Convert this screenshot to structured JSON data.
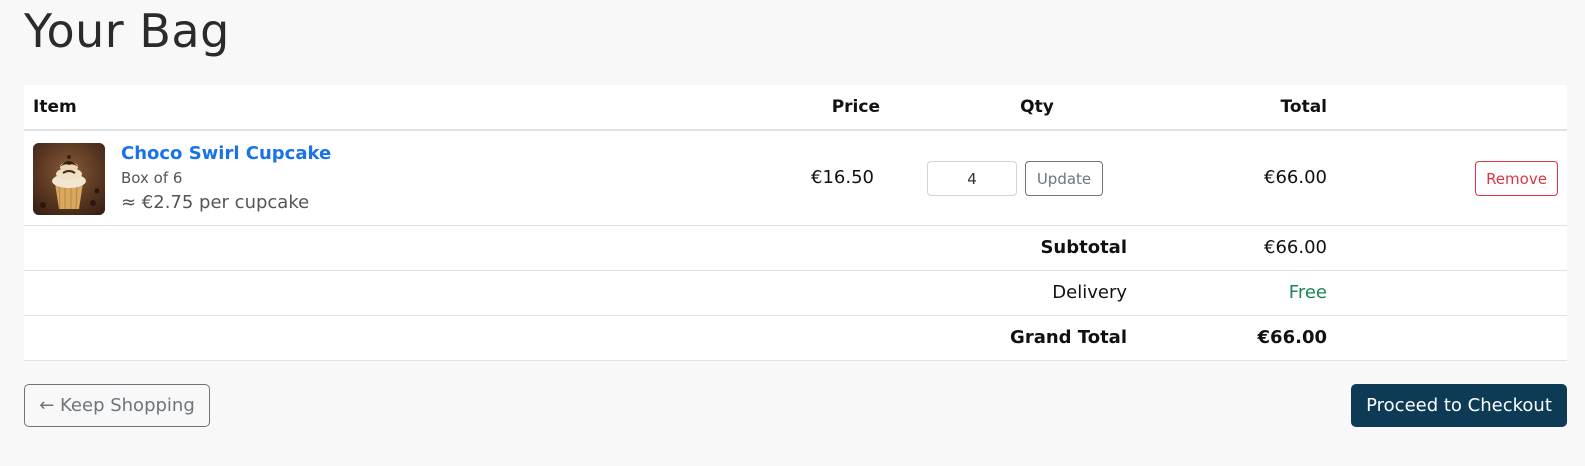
{
  "page": {
    "title": "Your Bag"
  },
  "table": {
    "headers": {
      "item": "Item",
      "price": "Price",
      "qty": "Qty",
      "total": "Total"
    },
    "items": [
      {
        "name": "Choco Swirl Cupcake",
        "variant": "Box of 6",
        "unit_price_note": "≈ €2.75 per cupcake",
        "price": "€16.50",
        "quantity": "4",
        "update_label": "Update",
        "line_total": "€66.00",
        "remove_label": "Remove",
        "image_icon": "cupcake-image"
      }
    ]
  },
  "summary": {
    "subtotal_label": "Subtotal",
    "subtotal_value": "€66.00",
    "delivery_label": "Delivery",
    "delivery_value": "Free",
    "grand_total_label": "Grand Total",
    "grand_total_value": "€66.00"
  },
  "actions": {
    "keep_shopping": "← Keep Shopping",
    "checkout": "Proceed to Checkout"
  },
  "colors": {
    "link": "#1a73e8",
    "danger": "#dc3545",
    "success": "#198754",
    "primary_dark": "#0d3b56"
  }
}
